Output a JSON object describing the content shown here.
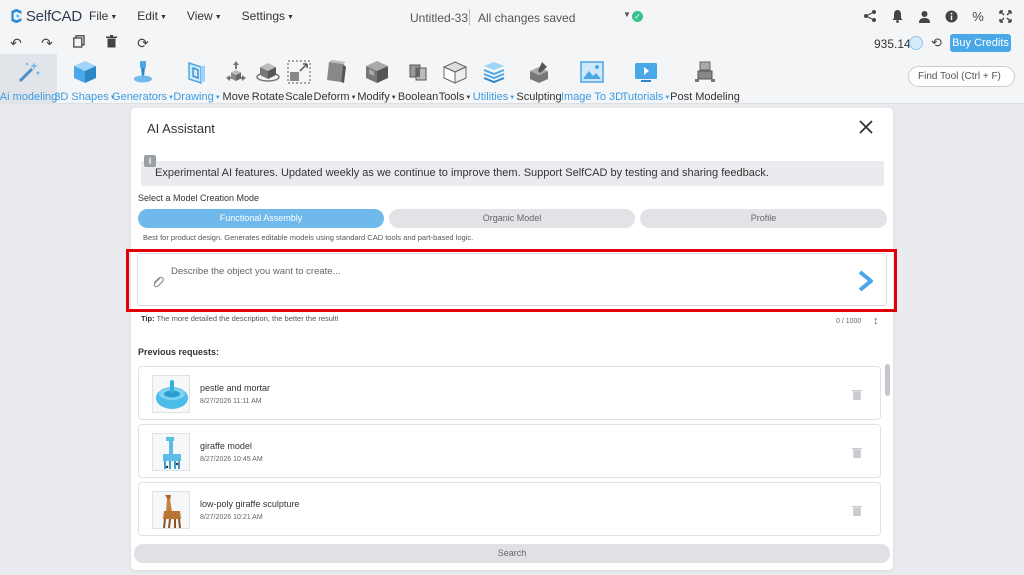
{
  "app": {
    "logo_text": "SelfCAD"
  },
  "menu": [
    {
      "label": "File"
    },
    {
      "label": "Edit"
    },
    {
      "label": "View"
    },
    {
      "label": "Settings"
    }
  ],
  "document": {
    "title": "Untitled-33",
    "status": "All changes saved"
  },
  "account": {
    "credits": "935.14",
    "buy_label": "Buy Credits"
  },
  "toolbar": {
    "tools": [
      {
        "label": "Ai modeling",
        "icon": "ai-wand-icon",
        "active": true
      },
      {
        "label": "3D Shapes",
        "icon": "cube-icon"
      },
      {
        "label": "Generators",
        "icon": "generator-pin-icon"
      },
      {
        "label": "Drawing",
        "icon": "drawing-icon"
      },
      {
        "label": "Move",
        "icon": "move-arrows-icon"
      },
      {
        "label": "Rotate",
        "icon": "rotate-icon"
      },
      {
        "label": "Scale",
        "icon": "scale-icon"
      },
      {
        "label": "Deform",
        "icon": "deform-icon"
      },
      {
        "label": "Modify",
        "icon": "modify-icon"
      },
      {
        "label": "Boolean",
        "icon": "boolean-icon"
      },
      {
        "label": "Tools",
        "icon": "tools-icon"
      },
      {
        "label": "Utilities",
        "icon": "utilities-icon"
      },
      {
        "label": "Sculpting",
        "icon": "sculpting-icon"
      },
      {
        "label": "Image To 3D",
        "icon": "image-to-3d-icon"
      },
      {
        "label": "Tutorials",
        "icon": "tutorials-icon"
      },
      {
        "label": "Post Modeling",
        "icon": "post-modeling-icon"
      }
    ],
    "find_tool_label": "Find Tool (Ctrl + F)"
  },
  "modal": {
    "title": "AI Assistant",
    "notice": "Experimental AI features. Updated weekly as we continue to improve them. Support SelfCAD by testing and sharing feedback.",
    "mode_label": "Select a Model Creation Mode",
    "modes": [
      {
        "label": "Functional Assembly",
        "active": true
      },
      {
        "label": "Organic Model",
        "active": false
      },
      {
        "label": "Profile",
        "active": false
      }
    ],
    "mode_description": "Best for product design. Generates editable models using standard CAD tools and part-based logic.",
    "prompt": {
      "placeholder": "Describe the object you want to create...",
      "value": ""
    },
    "tip_prefix": "Tip:",
    "tip_text": " The more detailed the description, the better the result!",
    "counter": "0 / 1000",
    "previous_title": "Previous requests:",
    "requests": [
      {
        "name": "pestle and mortar",
        "time": "8/27/2026 11:11 AM"
      },
      {
        "name": "giraffe model",
        "time": "8/27/2026 10:45 AM"
      },
      {
        "name": "low-poly giraffe sculpture",
        "time": "8/27/2026 10:21 AM"
      }
    ],
    "search_label": "Search"
  },
  "colors": {
    "accent": "#4aa8e8",
    "active_mode": "#6fb9ec",
    "highlight": "#e2000b",
    "saved": "#35c28b"
  }
}
